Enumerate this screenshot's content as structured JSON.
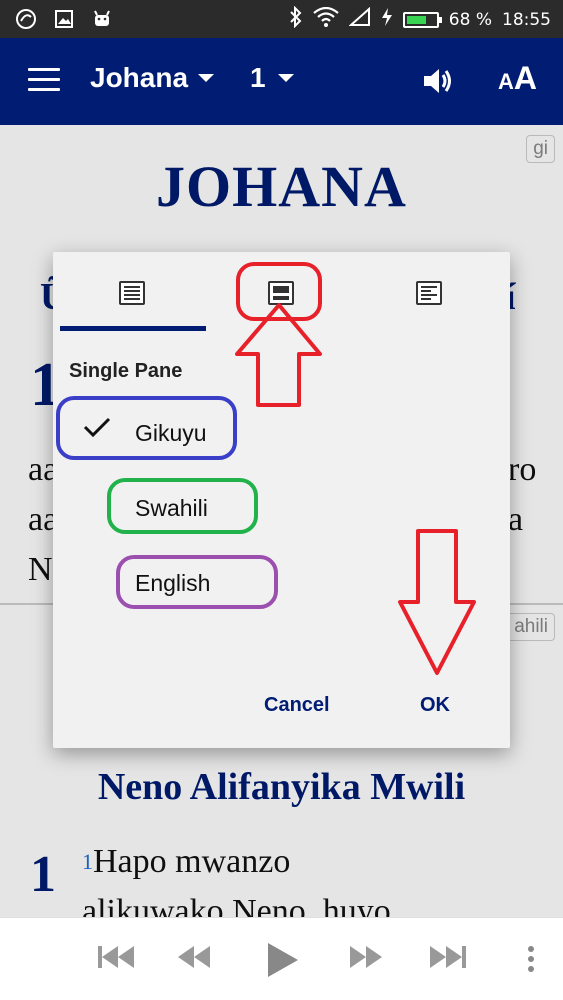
{
  "status_bar": {
    "battery_percent": "68 %",
    "battery_level": 0.68,
    "time": "18:55",
    "icons": [
      "app-icon",
      "gallery-icon",
      "android-icon",
      "bluetooth-icon",
      "wifi-icon",
      "signal-icon",
      "charging-icon",
      "battery-icon"
    ]
  },
  "app_bar": {
    "book": "Johana",
    "chapter": "1",
    "text_size_label_small": "A",
    "text_size_label_big": "A"
  },
  "pane1": {
    "language_tag": "gi",
    "book_title": "JOHANA",
    "section_heading_start": "Ũ",
    "section_heading_end": "í",
    "chapter_number": "1",
    "line1_start": "aa",
    "line1_end": "ro",
    "line2_start": "aa",
    "line2_end": "a",
    "line3_start": "N"
  },
  "pane2": {
    "language_tag": "ahili",
    "section_heading": "Neno Alifanyika Mwili",
    "chapter_number": "1",
    "verse_number": "1",
    "verse_line1": "Hapo mwanzo",
    "verse_line2": "alikuwako Neno, huyo"
  },
  "dialog": {
    "heading": "Single Pane",
    "options": [
      "Gikuyu",
      "Swahili",
      "English"
    ],
    "selected_option": "Gikuyu",
    "cancel_label": "Cancel",
    "ok_label": "OK"
  },
  "colors": {
    "app_bar": "#011c73",
    "status_bar": "#2b2b2b",
    "annotation_red": "#e8202a",
    "annotation_blue": "#3b3fc8",
    "annotation_green": "#22b24c",
    "annotation_purple": "#9b4fae"
  }
}
